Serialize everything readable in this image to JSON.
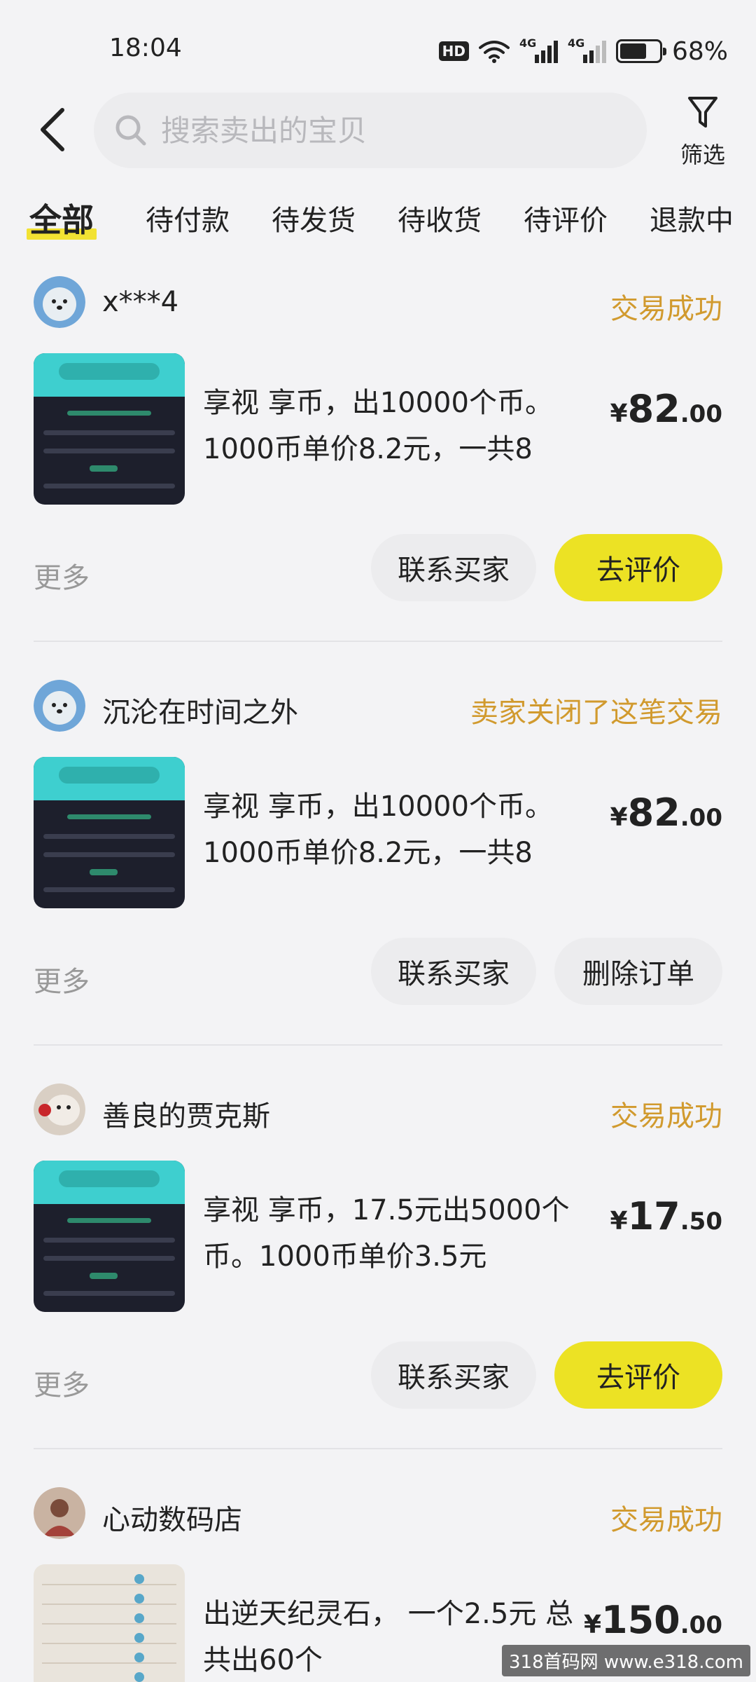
{
  "status_bar": {
    "time": "18:04",
    "hd": "HD",
    "net1": "4G",
    "net2": "4G",
    "battery_percent": "68%",
    "battery_level": 0.68
  },
  "header": {
    "search_placeholder": "搜索卖出的宝贝",
    "filter_label": "筛选"
  },
  "tabs": [
    {
      "label": "全部",
      "active": true
    },
    {
      "label": "待付款"
    },
    {
      "label": "待发货"
    },
    {
      "label": "待收货"
    },
    {
      "label": "待评价"
    },
    {
      "label": "退款中"
    }
  ],
  "orders": [
    {
      "buyer": "x***4",
      "status": "交易成功",
      "title": "享视 享币，出10000个币。1000币单价8.2元，一共8",
      "price": {
        "currency": "¥",
        "int": "82",
        "dec": ".00"
      },
      "more": "更多",
      "buttons": [
        "联系买家",
        "去评价"
      ]
    },
    {
      "buyer": "沉沦在时间之外",
      "status": "卖家关闭了这笔交易",
      "title": "享视 享币，出10000个币。1000币单价8.2元，一共8",
      "price": {
        "currency": "¥",
        "int": "82",
        "dec": ".00"
      },
      "more": "更多",
      "buttons": [
        "联系买家",
        "删除订单"
      ]
    },
    {
      "buyer": "善良的贾克斯",
      "status": "交易成功",
      "title": "享视 享币，17.5元出5000个币。1000币单价3.5元",
      "price": {
        "currency": "¥",
        "int": "17",
        "dec": ".50"
      },
      "more": "更多",
      "buttons": [
        "联系买家",
        "去评价"
      ]
    },
    {
      "buyer": "心动数码店",
      "status": "交易成功",
      "title": "出逆天纪灵石， 一个2.5元 总共出60个",
      "price": {
        "currency": "¥",
        "int": "150",
        "dec": ".00"
      }
    }
  ],
  "watermark": "318首码网 www.e318.com",
  "colors": {
    "accent_yellow": "#ece224",
    "status_orange": "#d19a2e",
    "background": "#f3f3f5"
  }
}
